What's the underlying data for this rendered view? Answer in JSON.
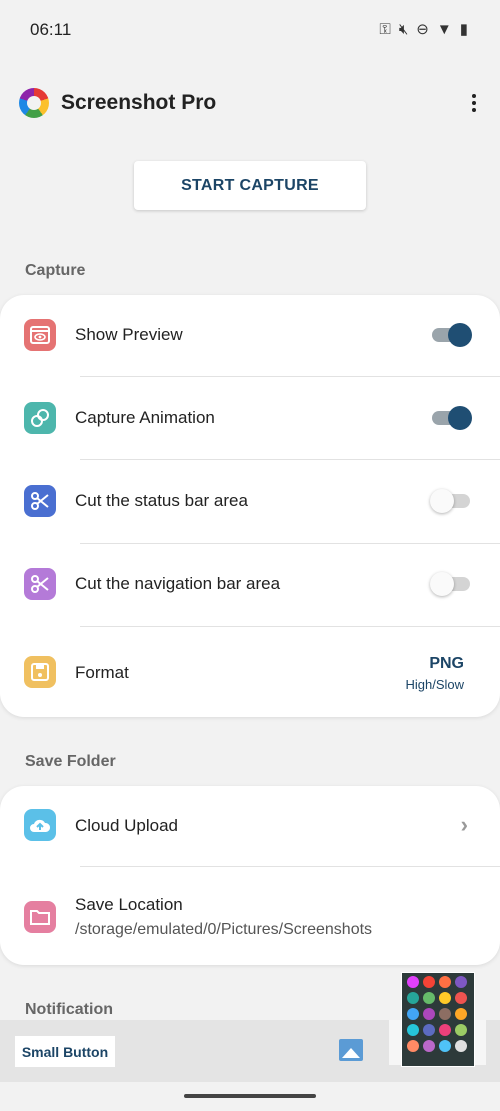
{
  "status": {
    "time": "06:11"
  },
  "app": {
    "title": "Screenshot Pro"
  },
  "start_button": "START CAPTURE",
  "sections": {
    "capture": "Capture",
    "save_folder": "Save Folder",
    "notification": "Notification"
  },
  "capture_items": {
    "show_preview": {
      "label": "Show Preview",
      "enabled": true,
      "icon": "preview-icon",
      "color": "#e57373"
    },
    "capture_animation": {
      "label": "Capture Animation",
      "enabled": true,
      "icon": "animation-icon",
      "color": "#4db6ac"
    },
    "cut_status": {
      "label": "Cut the status bar area",
      "enabled": false,
      "icon": "scissors-icon",
      "color": "#4a6fd1"
    },
    "cut_nav": {
      "label": "Cut the navigation bar area",
      "enabled": false,
      "icon": "scissors-icon",
      "color": "#b47ad8"
    },
    "format": {
      "label": "Format",
      "value": "PNG",
      "detail": "High/Slow",
      "icon": "save-icon",
      "color": "#f0c060"
    }
  },
  "save_items": {
    "cloud": {
      "label": "Cloud Upload",
      "icon": "cloud-upload-icon",
      "color": "#5bc0e8"
    },
    "location": {
      "label": "Save Location",
      "path": "/storage/emulated/0/Pictures/Screenshots",
      "icon": "folder-icon",
      "color": "#e57fa0"
    }
  },
  "bottom": {
    "small_button": "Small Button"
  },
  "colors": {
    "accent": "#1c4566",
    "toggle_on": "#1f4e73"
  }
}
